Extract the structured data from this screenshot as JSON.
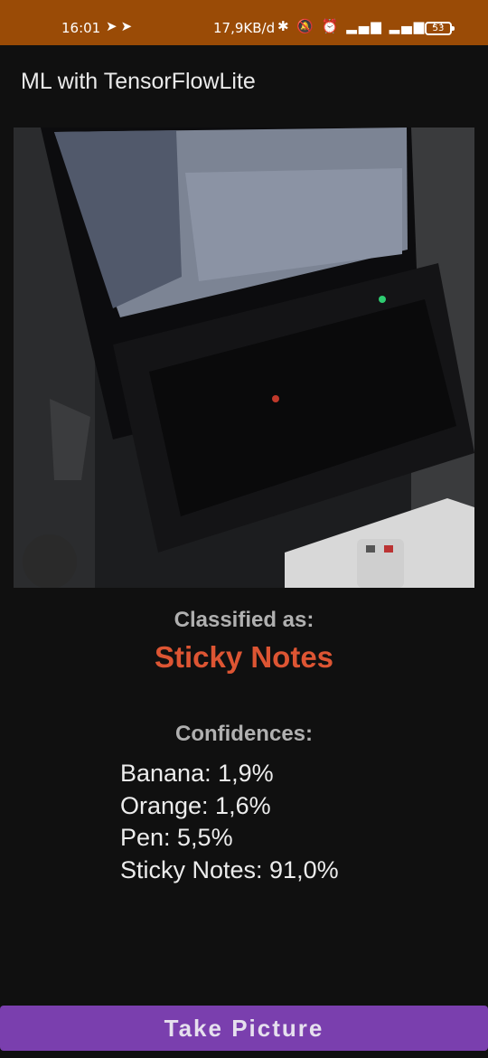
{
  "status_bar": {
    "time": "16:01",
    "net_speed": "17,9KB/d",
    "battery": "53"
  },
  "app": {
    "title": "ML with TensorFlowLite"
  },
  "result": {
    "label": "Classified as:",
    "value": "Sticky Notes"
  },
  "confidences": {
    "label": "Confidences:",
    "items": [
      "Banana: 1,9%",
      "Orange: 1,6%",
      "Pen: 5,5%",
      "Sticky Notes: 91,0%"
    ]
  },
  "actions": {
    "take_picture": "Take Picture"
  },
  "colors": {
    "status_bar": "#9a4b06",
    "result": "#dd5533",
    "button": "#7a3fae",
    "background": "#101010"
  }
}
